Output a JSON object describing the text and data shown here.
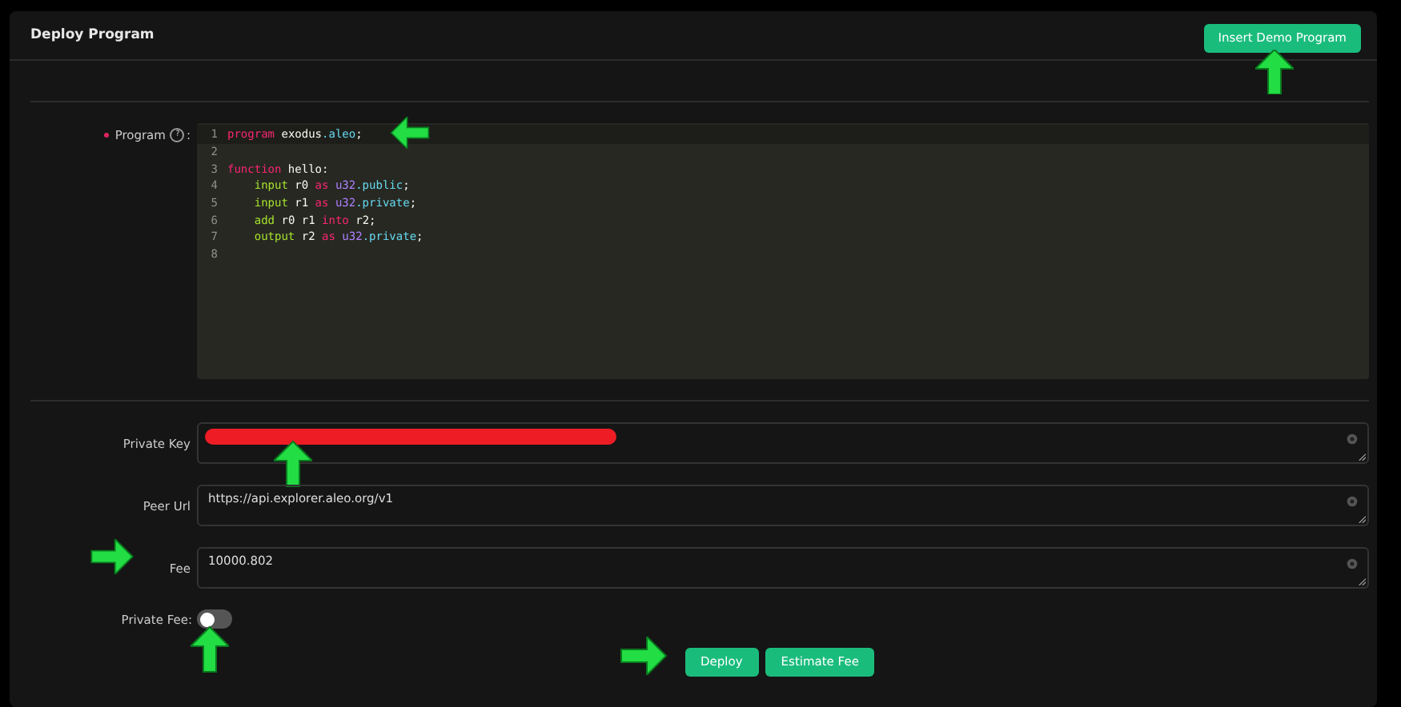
{
  "card": {
    "title": "Deploy Program",
    "action_button": {
      "label": "Insert Demo Program",
      "arrow_below": true
    }
  },
  "program_field": {
    "label": "Program",
    "required": true,
    "help": "?",
    "suffix": ":",
    "lines": [
      {
        "number": "1",
        "arrow_after": true,
        "tokens": [
          {
            "text": "program",
            "kind": "keyword"
          },
          {
            "text": " exodus",
            "kind": "plain"
          },
          {
            "text": ".aleo",
            "kind": "type"
          },
          {
            "text": ";",
            "kind": "plain"
          }
        ]
      },
      {
        "number": "2"
      },
      {
        "number": "3",
        "tokens": [
          {
            "text": "function",
            "kind": "keyword"
          },
          {
            "text": " hello:",
            "kind": "plain"
          }
        ]
      },
      {
        "number": "4",
        "tokens": [
          {
            "text": "    input",
            "kind": "instr"
          },
          {
            "text": " r0 ",
            "kind": "plain"
          },
          {
            "text": "as",
            "kind": "keyword"
          },
          {
            "text": " u32",
            "kind": "num"
          },
          {
            "text": ".public",
            "kind": "type"
          },
          {
            "text": ";",
            "kind": "plain"
          }
        ]
      },
      {
        "number": "5",
        "tokens": [
          {
            "text": "    input",
            "kind": "instr"
          },
          {
            "text": " r1 ",
            "kind": "plain"
          },
          {
            "text": "as",
            "kind": "keyword"
          },
          {
            "text": " u32",
            "kind": "num"
          },
          {
            "text": ".private",
            "kind": "type"
          },
          {
            "text": ";",
            "kind": "plain"
          }
        ]
      },
      {
        "number": "6",
        "tokens": [
          {
            "text": "    add",
            "kind": "instr"
          },
          {
            "text": " r0 r1 ",
            "kind": "plain"
          },
          {
            "text": "into",
            "kind": "keyword"
          },
          {
            "text": " r2;",
            "kind": "plain"
          }
        ]
      },
      {
        "number": "7",
        "tokens": [
          {
            "text": "    output",
            "kind": "instr"
          },
          {
            "text": " r2 ",
            "kind": "plain"
          },
          {
            "text": "as",
            "kind": "keyword"
          },
          {
            "text": " u32",
            "kind": "num"
          },
          {
            "text": ".private",
            "kind": "type"
          },
          {
            "text": ";",
            "kind": "plain"
          }
        ]
      },
      {
        "number": "8"
      }
    ]
  },
  "fields": [
    {
      "label": "Private Key",
      "redacted": true,
      "arrow_below": true
    },
    {
      "label": "Peer Url",
      "value": "https://api.explorer.aleo.org/v1"
    },
    {
      "label": "Fee",
      "value": "10000.802",
      "arrow_before_label": true
    }
  ],
  "private_fee": {
    "label": "Private Fee:",
    "on": false,
    "arrow_below": true
  },
  "buttons": [
    {
      "label": "Deploy",
      "arrow_before": true
    },
    {
      "label": "Estimate Fee"
    }
  ]
}
